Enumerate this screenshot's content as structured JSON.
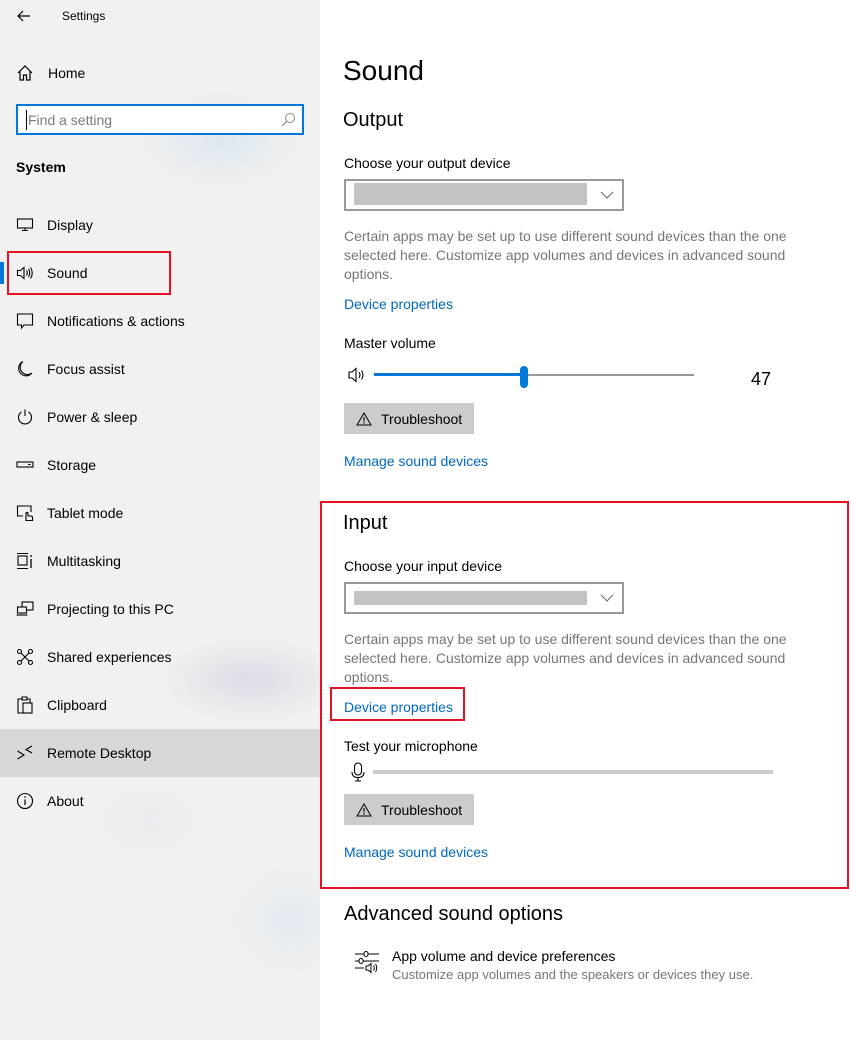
{
  "window": {
    "title": "Settings"
  },
  "sidebar": {
    "home_label": "Home",
    "search": {
      "placeholder": "Find a setting",
      "value": ""
    },
    "section_label": "System",
    "items": [
      {
        "label": "Display",
        "icon": "display-icon"
      },
      {
        "label": "Sound",
        "icon": "speaker-icon",
        "active": true
      },
      {
        "label": "Notifications & actions",
        "icon": "notifications-icon"
      },
      {
        "label": "Focus assist",
        "icon": "moon-icon"
      },
      {
        "label": "Power & sleep",
        "icon": "power-icon"
      },
      {
        "label": "Storage",
        "icon": "storage-icon"
      },
      {
        "label": "Tablet mode",
        "icon": "tablet-mode-icon"
      },
      {
        "label": "Multitasking",
        "icon": "multitasking-icon"
      },
      {
        "label": "Projecting to this PC",
        "icon": "projecting-icon"
      },
      {
        "label": "Shared experiences",
        "icon": "shared-experiences-icon"
      },
      {
        "label": "Clipboard",
        "icon": "clipboard-icon"
      },
      {
        "label": "Remote Desktop",
        "icon": "remote-desktop-icon",
        "hovered": true
      },
      {
        "label": "About",
        "icon": "info-icon"
      }
    ]
  },
  "main": {
    "title": "Sound",
    "output": {
      "heading": "Output",
      "device_label": "Choose your output device",
      "device_value": "",
      "description": "Certain apps may be set up to use different sound devices than the one selected here. Customize app volumes and devices in advanced sound options.",
      "device_properties_link": "Device properties",
      "master_volume_label": "Master volume",
      "master_volume_value": 47,
      "master_volume_display": "47",
      "troubleshoot_label": "Troubleshoot",
      "manage_link": "Manage sound devices"
    },
    "input": {
      "heading": "Input",
      "device_label": "Choose your input device",
      "device_value": "",
      "description": "Certain apps may be set up to use different sound devices than the one selected here. Customize app volumes and devices in advanced sound options.",
      "device_properties_link": "Device properties",
      "test_label": "Test your microphone",
      "mic_level": 0,
      "troubleshoot_label": "Troubleshoot",
      "manage_link": "Manage sound devices"
    },
    "advanced": {
      "heading": "Advanced sound options",
      "item_title": "App volume and device preferences",
      "item_subtitle": "Customize app volumes and the speakers or devices they use."
    }
  },
  "colors": {
    "accent": "#0078d7",
    "link": "#0067c0",
    "annotation": "#e81123",
    "button_bg": "#cccccc"
  }
}
